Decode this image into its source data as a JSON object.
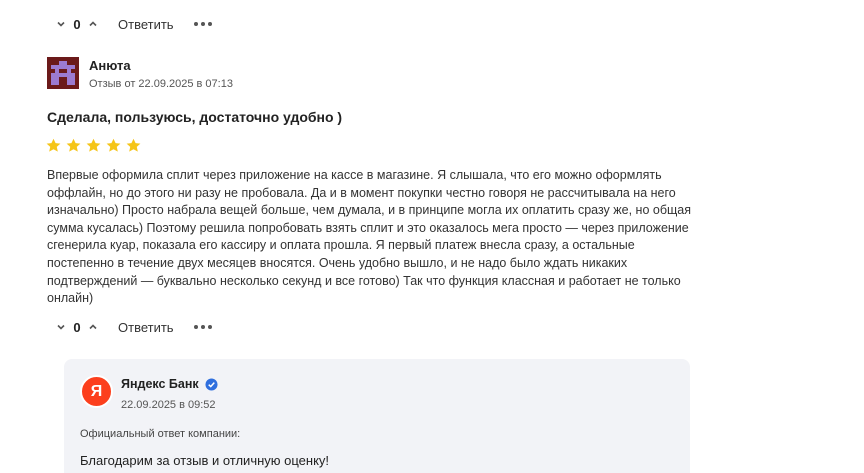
{
  "top_actions": {
    "count": "0",
    "reply_label": "Ответить"
  },
  "review": {
    "author": "Анюта",
    "date": "Отзыв от 22.09.2025 в 07:13",
    "title": "Сделала, пользуюсь, достаточно удобно )",
    "rating": 5,
    "rating_max": 5,
    "star_color": "#f5c518",
    "avatar_colors": {
      "background": "#6b1a1a",
      "figure": "#9c7bd1"
    },
    "body": "Впервые оформила сплит через приложение на кассе в магазине. Я слышала, что его можно оформлять оффлайн, но до этого ни разу не пробовала. Да и в момент покупки честно говоря не рассчитывала на него изначально) Просто набрала вещей больше, чем думала, и в принципе могла их оплатить сразу же, но общая сумма кусалась) Поэтому решила попробовать взять сплит и это оказалось мега просто — через приложение сгенерила куар, показала его кассиру и оплата прошла. Я первый платеж внесла сразу, а остальные постепенно в течение двух месяцев вносятся. Очень удобно вышло, и не надо было ждать никаких подтверждений — буквально несколько секунд и все готово) Так что функция классная и работает не только онлайн)",
    "actions": {
      "count": "0",
      "reply_label": "Ответить"
    }
  },
  "company_reply": {
    "logo_letter": "Я",
    "logo_color": "#fc3f1d",
    "company": "Яндекс Банк",
    "verified_color": "#2f6fde",
    "date": "22.09.2025 в 09:52",
    "label": "Официальный ответ компании:",
    "text": "Благодарим за отзыв и отличную оценку!"
  }
}
